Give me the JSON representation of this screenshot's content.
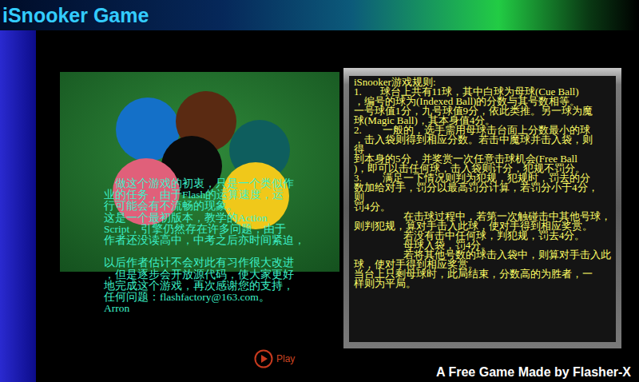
{
  "header": {
    "title": "iSnooker Game"
  },
  "intro": {
    "paragraphs": [
      [
        "    做这个游戏的初衷，只是一个类似作",
        "业的任务，由于Flash的运算速度，运",
        "行可能会有不流畅的现象。",
        "这是一个最初版本，教学的Action",
        "Script，引擎仍然存在许多问题，由于",
        "作者还没读高中，中考之后亦时间紧迫，"
      ],
      [
        "以后作者估计不会对此有习作很大改进",
        "，但是逐步会开放源代码，使大家更好",
        "地完成这个游戏，再次感谢您的支持，",
        "任何问题：flashfactory@163.com。",
        "Arron"
      ]
    ]
  },
  "rules": {
    "lines": [
      "iSnooker游戏规则:",
      "1.       球台上共有11球，其中白球为母球(Cue Ball)",
      "，编号的球为(Indexed Ball)的分数与其号数相等。",
      "一号球值1分，九号球值9分，依此类推。另一球为魔",
      "球(Magic Ball)，其本身值4分。",
      "2.        一般的，选手需用母球击台面上分数最小的球",
      "，击入袋则得到相应分数。若击中魔球并击入袋，则",
      "得",
      "到本身的5分，并奖赏一次任意击球机会(Free Ball",
      ")，即可以击任何球，击入袋则计分，犯规不罚分。",
      "3.        满足一下情况则判为犯规，犯规时，罚去的分",
      "数加给对手，罚分以最高罚分计算，若罚分小于4分，",
      "则",
      "罚4分。",
      "                   在击球过程中，若第一次触碰击中其他号球，",
      "则判犯规，算对手击入此球，使对手得到相应奖赏。",
      "                   若没有击中任何球，判犯规，罚去4分。",
      "                   母球入袋，罚4分。",
      "                   若将其他号数的球击入袋中，则算对手击入此",
      "球，使对手得到相应奖赏。",
      "当台上只剩母球时，此局结束，分数高的为胜者，一",
      "样则为平局。"
    ]
  },
  "play_button": {
    "label": "Play"
  },
  "footer": {
    "text": "A Free Game Made by Flasher-X"
  }
}
